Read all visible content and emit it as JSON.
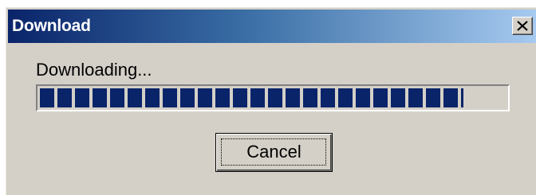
{
  "window": {
    "title": "Download",
    "close_icon": "close-x-icon"
  },
  "body": {
    "status_text": "Downloading...",
    "progress_percent": 91
  },
  "buttons": {
    "cancel_label": "Cancel"
  },
  "colors": {
    "title_start": "#0a246a",
    "title_end": "#a6caf0",
    "face": "#d4d0c8",
    "progress_fill": "#0a246a"
  }
}
